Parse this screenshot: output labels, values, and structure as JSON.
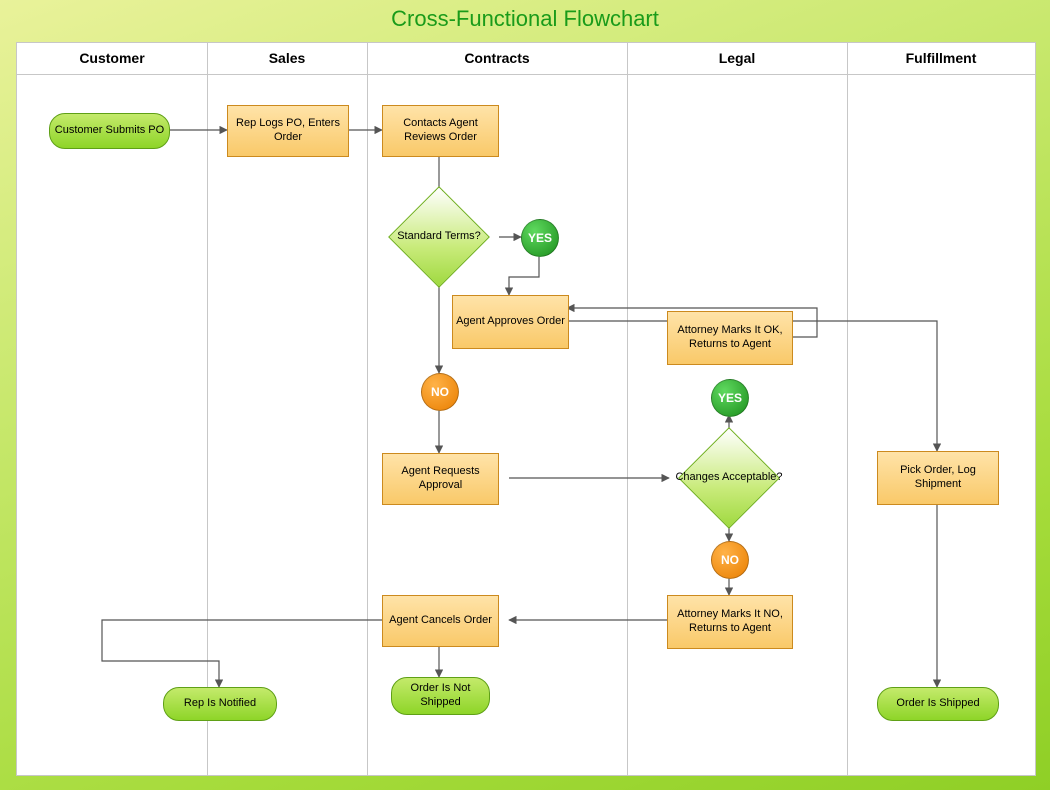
{
  "title": "Cross-Functional Flowchart",
  "lanes": {
    "customer": "Customer",
    "sales": "Sales",
    "contracts": "Contracts",
    "legal": "Legal",
    "fulfillment": "Fulfillment"
  },
  "shapes": {
    "start": "Customer Submits PO",
    "rep_logs": "Rep Logs PO, Enters Order",
    "agent_reviews": "Contacts Agent Reviews Order",
    "standard_terms": "Standard Terms?",
    "approves": "Agent Approves Order",
    "requests": "Agent Requests Approval",
    "cancels": "Agent Cancels Order",
    "atty_ok": "Attorney Marks It OK, Returns to Agent",
    "atty_no": "Attorney Marks It NO, Returns to Agent",
    "changes": "Changes Acceptable?",
    "pick": "Pick Order, Log Shipment",
    "rep_notified": "Rep Is Notified",
    "not_shipped": "Order Is Not Shipped",
    "shipped": "Order Is Shipped"
  },
  "labels": {
    "yes": "YES",
    "no": "NO"
  },
  "lane_x": {
    "customer": 0,
    "sales": 190,
    "contracts": 350,
    "legal": 610,
    "fulfillment": 830,
    "end": 1018
  }
}
